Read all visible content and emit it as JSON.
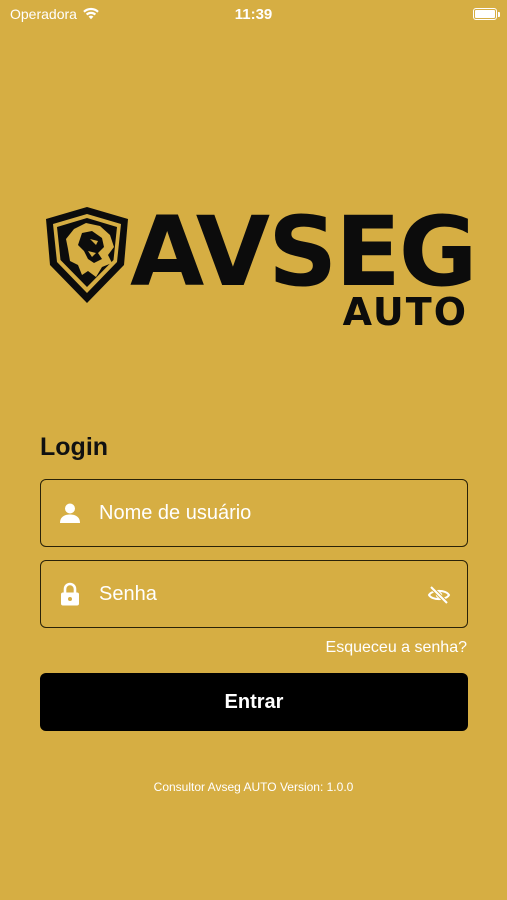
{
  "status_bar": {
    "carrier": "Operadora",
    "time": "11:39"
  },
  "logo": {
    "word": "AVSEG",
    "sub": "AUTO"
  },
  "login": {
    "title": "Login",
    "username_placeholder": "Nome de usuário",
    "password_placeholder": "Senha",
    "forgot_label": "Esqueceu a senha?",
    "submit_label": "Entrar"
  },
  "footer": {
    "version_text": "Consultor Avseg AUTO Version: 1.0.0"
  },
  "colors": {
    "background": "#D6AE43",
    "button": "#000000",
    "text_light": "#FFFFFF"
  },
  "icons": {
    "username": "person-icon",
    "password": "lock-icon",
    "visibility": "eye-off-icon"
  }
}
